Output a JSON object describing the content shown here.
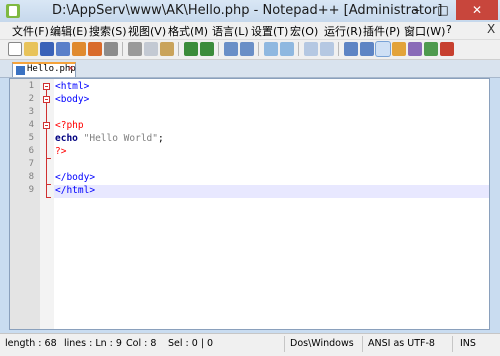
{
  "window": {
    "title": "D:\\AppServ\\www\\AK\\Hello.php - Notepad++ [Administrator]",
    "minimize": "–",
    "maximize": "□",
    "close": "✕"
  },
  "menu": {
    "items": [
      "文件(F)",
      "编辑(E)",
      "搜索(S)",
      "视图(V)",
      "格式(M)",
      "语言(L)",
      "设置(T)",
      "宏(O)",
      "运行(R)",
      "插件(P)",
      "窗口(W)",
      "?"
    ],
    "close": "X"
  },
  "toolbar": {
    "icons": [
      "new-file-icon",
      "open-file-icon",
      "save-icon",
      "save-all-icon",
      "close-icon",
      "close-all-icon",
      "print-icon",
      "cut-icon",
      "copy-icon",
      "paste-icon",
      "undo-icon",
      "redo-icon",
      "find-icon",
      "replace-icon",
      "zoom-in-icon",
      "zoom-out-icon",
      "sync-scroll-v-icon",
      "sync-scroll-h-icon",
      "word-wrap-icon",
      "show-all-chars-icon",
      "indent-guide-icon",
      "user-define-dialog-icon",
      "doc-map-icon",
      "function-list-icon",
      "macro-record-icon"
    ]
  },
  "tab": {
    "label": "Hello.php",
    "close": "✕"
  },
  "editor": {
    "lines": [
      {
        "num": "1",
        "text": "<html>"
      },
      {
        "num": "2",
        "text": "<body>"
      },
      {
        "num": "3",
        "text": ""
      },
      {
        "num": "4",
        "text_open": "<?php"
      },
      {
        "num": "5",
        "kw": "echo",
        "str": "\"Hello World\"",
        "end": ";"
      },
      {
        "num": "6",
        "text_close": "?>"
      },
      {
        "num": "7",
        "text": ""
      },
      {
        "num": "8",
        "text": "</body>"
      },
      {
        "num": "9",
        "text": "</html>"
      }
    ]
  },
  "status": {
    "length": "length : 68",
    "lines": "lines : Ln : 9",
    "col": "Col : 8",
    "sel": "Sel : 0 | 0",
    "eol": "Dos\\Windows",
    "encoding": "ANSI as UTF-8",
    "mode": "INS"
  },
  "colors": {
    "tag": "#0000ff",
    "php_tag": "#ff0000",
    "keyword": "#000080",
    "string": "#808080",
    "fold": "#d03030",
    "current_line": "#e8e8ff"
  }
}
